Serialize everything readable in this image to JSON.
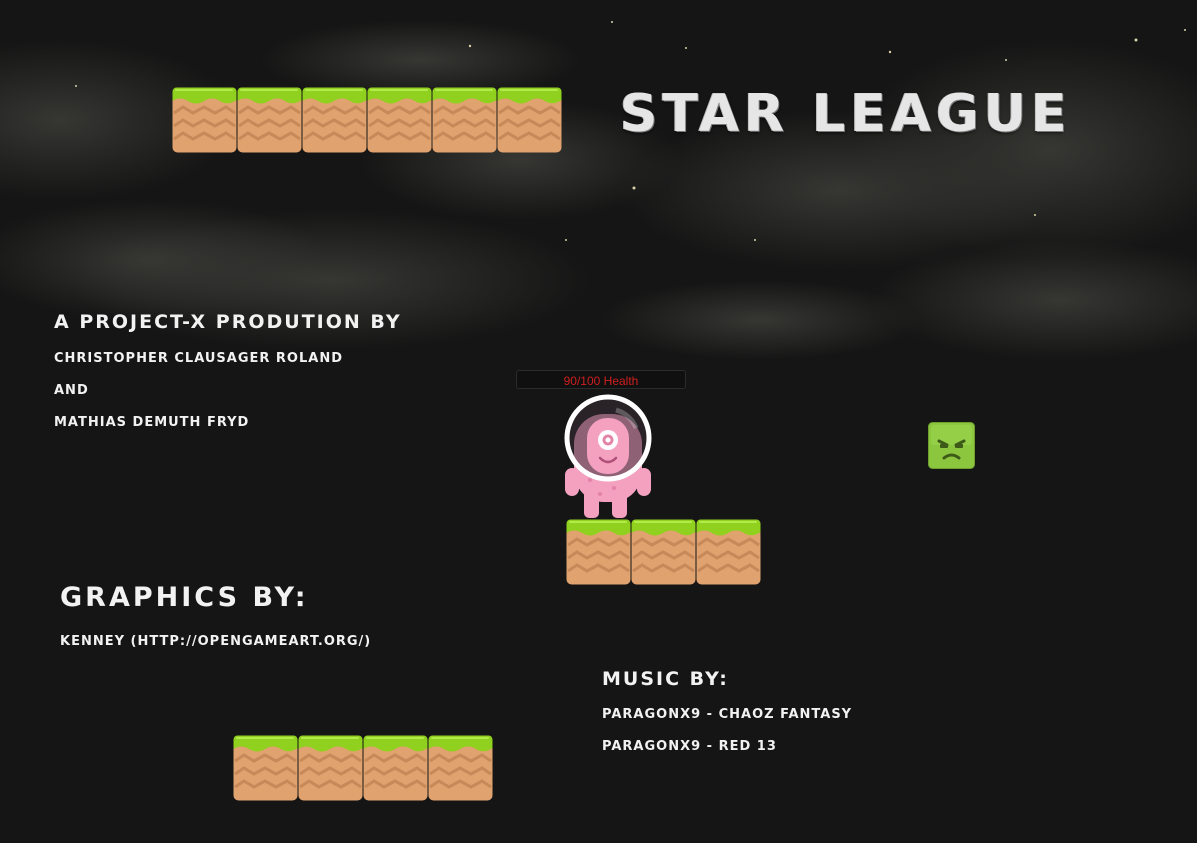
{
  "game": {
    "title": "STAR LEAGUE",
    "credits": {
      "production": {
        "heading": "A PROJECT-X PRODUTION BY",
        "author1": "CHRISTOPHER CLAUSAGER ROLAND",
        "and": "AND",
        "author2": "MATHIAS DEMUTH FRYD"
      },
      "graphics": {
        "heading": "GRAPHICS BY:",
        "credit": "KENNEY (HTTP://OPENGAMEART.ORG/)"
      },
      "music": {
        "heading": "MUSIC BY:",
        "track1": "PARAGONX9 - CHAOZ FANTASY",
        "track2": "PARAGONX9 - RED 13"
      }
    },
    "player": {
      "health_text": "90/100 Health",
      "health": 90,
      "max_health": 100
    },
    "icons": {
      "player": "pink-alien-astronaut-icon",
      "enemy": "green-slime-block-icon",
      "platform": "grass-dirt-platform-icon"
    },
    "colors": {
      "background": "#141414",
      "grass": "#8fd11e",
      "dirt": "#e0a26e",
      "health_text": "#d11f1f",
      "alien": "#f4a1c0",
      "slime": "#8cc63f"
    }
  }
}
